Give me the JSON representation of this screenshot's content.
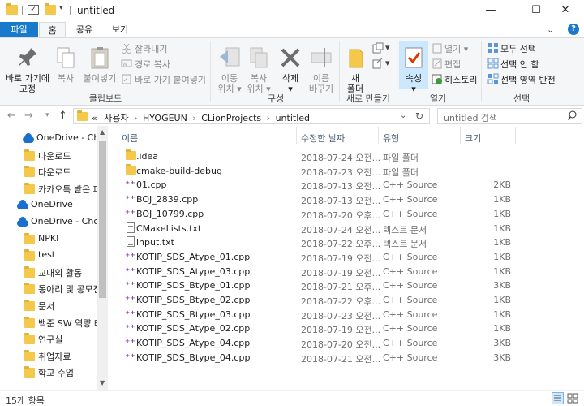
{
  "window": {
    "title": "untitled",
    "minimize": "—",
    "maximize": "☐",
    "close": "✕"
  },
  "tabs": [
    "파일",
    "홈",
    "공유",
    "보기"
  ],
  "ribbon": {
    "clipboard": {
      "pin_label_1": "바로 가기에",
      "pin_label_2": "고정",
      "copy": "복사",
      "paste": "붙여넣기",
      "cut": "잘라내기",
      "copy_path": "경로 복사",
      "paste_shortcut": "바로 가기 붙여넣기",
      "group": "클립보드"
    },
    "organize": {
      "move_1": "이동",
      "move_2": "위치 ▾",
      "copyto_1": "복사",
      "copyto_2": "위치 ▾",
      "delete_1": "삭제",
      "delete_2": "▾",
      "rename_1": "이름",
      "rename_2": "바꾸기",
      "group": "구성"
    },
    "new": {
      "new_1": "새",
      "new_2": "폴더",
      "group": "새로 만들기"
    },
    "open": {
      "props_1": "속성",
      "props_2": "▾",
      "open": "열기 ▾",
      "edit": "편집",
      "history": "히스토리",
      "group": "열기"
    },
    "select": {
      "all": "모두 선택",
      "none": "선택 안 함",
      "invert": "선택 영역 반전",
      "group": "선택"
    }
  },
  "address": {
    "path": [
      "«",
      "사용자",
      "HYOGEUN",
      "CLionProjects",
      "untitled"
    ],
    "search_placeholder": "untitled 검색"
  },
  "nav": [
    {
      "type": "cloud",
      "label": "OneDrive - Cho",
      "indent": 1
    },
    {
      "type": "folder",
      "label": "다운로드",
      "indent": 2
    },
    {
      "type": "folder",
      "label": "다운로드",
      "indent": 2
    },
    {
      "type": "folder",
      "label": "카카오톡 받은 파",
      "indent": 2
    },
    {
      "type": "cloud",
      "label": "OneDrive",
      "indent": 0
    },
    {
      "type": "cloud",
      "label": "OneDrive - Chonn",
      "indent": 0
    },
    {
      "type": "folder",
      "label": "NPKI",
      "indent": 2
    },
    {
      "type": "folder",
      "label": "test",
      "indent": 2
    },
    {
      "type": "folder",
      "label": "교내외 활동",
      "indent": 2
    },
    {
      "type": "folder",
      "label": "동아리 및 공모전",
      "indent": 2
    },
    {
      "type": "folder",
      "label": "문서",
      "indent": 2
    },
    {
      "type": "folder",
      "label": "백준 SW 역량 테",
      "indent": 2
    },
    {
      "type": "folder",
      "label": "연구실",
      "indent": 2
    },
    {
      "type": "folder",
      "label": "취업자료",
      "indent": 2
    },
    {
      "type": "folder",
      "label": "학교 수업",
      "indent": 2
    }
  ],
  "columns": {
    "name": "이름",
    "date": "수정한 날짜",
    "type": "유형",
    "size": "크기"
  },
  "files": [
    {
      "icon": "folder",
      "name": ".idea",
      "date": "2018-07-24 오전...",
      "type": "파일 폴더",
      "size": ""
    },
    {
      "icon": "folder",
      "name": "cmake-build-debug",
      "date": "2018-07-23 오전...",
      "type": "파일 폴더",
      "size": ""
    },
    {
      "icon": "cpp",
      "name": "01.cpp",
      "date": "2018-07-13 오전...",
      "type": "C++ Source",
      "size": "2KB"
    },
    {
      "icon": "cpp",
      "name": "BOJ_2839.cpp",
      "date": "2018-07-13 오전...",
      "type": "C++ Source",
      "size": "1KB"
    },
    {
      "icon": "cpp",
      "name": "BOJ_10799.cpp",
      "date": "2018-07-20 오후...",
      "type": "C++ Source",
      "size": "1KB"
    },
    {
      "icon": "txt",
      "name": "CMakeLists.txt",
      "date": "2018-07-24 오전...",
      "type": "텍스트 문서",
      "size": "1KB"
    },
    {
      "icon": "txt",
      "name": "input.txt",
      "date": "2018-07-22 오후...",
      "type": "텍스트 문서",
      "size": "1KB"
    },
    {
      "icon": "cpp",
      "name": "KOTIP_SDS_Atype_01.cpp",
      "date": "2018-07-19 오전...",
      "type": "C++ Source",
      "size": "1KB"
    },
    {
      "icon": "cpp",
      "name": "KOTIP_SDS_Atype_03.cpp",
      "date": "2018-07-19 오전...",
      "type": "C++ Source",
      "size": "1KB"
    },
    {
      "icon": "cpp",
      "name": "KOTIP_SDS_Btype_01.cpp",
      "date": "2018-07-21 오후...",
      "type": "C++ Source",
      "size": "3KB"
    },
    {
      "icon": "cpp",
      "name": "KOTIP_SDS_Btype_02.cpp",
      "date": "2018-07-22 오후...",
      "type": "C++ Source",
      "size": "1KB"
    },
    {
      "icon": "cpp",
      "name": "KOTIP_SDS_Btype_03.cpp",
      "date": "2018-07-23 오전...",
      "type": "C++ Source",
      "size": "1KB"
    },
    {
      "icon": "cpp",
      "name": "KOTIP_SDS_Atype_02.cpp",
      "date": "2018-07-19 오전...",
      "type": "C++ Source",
      "size": "1KB"
    },
    {
      "icon": "cpp",
      "name": "KOTIP_SDS_Atype_04.cpp",
      "date": "2018-07-20 오전...",
      "type": "C++ Source",
      "size": "3KB"
    },
    {
      "icon": "cpp",
      "name": "KOTIP_SDS_Btype_04.cpp",
      "date": "2018-07-21 오전...",
      "type": "C++ Source",
      "size": "3KB"
    }
  ],
  "status": {
    "count": "15개 항목"
  },
  "colors": {
    "accent": "#1979ca",
    "folder": "#f4c84a",
    "cpp": "#8a3da6",
    "onedrive": "#1b6fd0"
  }
}
